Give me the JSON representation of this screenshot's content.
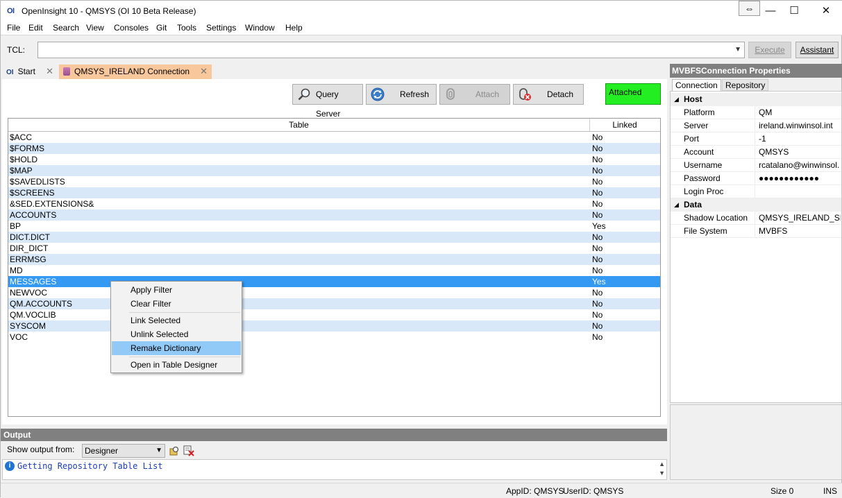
{
  "window": {
    "app_logo": "OI",
    "title": "OpenInsight 10 - QMSYS (OI 10 Beta Release)",
    "swap_glyph": "⇔",
    "minimize_glyph": "—",
    "maximize_glyph": "☐",
    "close_glyph": "✕"
  },
  "menu": [
    "File",
    "Edit",
    "Search",
    "View",
    "Consoles",
    "Git",
    "Tools",
    "Settings",
    "Window",
    "Help"
  ],
  "tcl": {
    "label": "TCL:",
    "value": "",
    "execute_label": "Execute",
    "assistant_label": "Assistant"
  },
  "tabs": {
    "start_label": "Start",
    "start_logo": "OI",
    "connection_label": "QMSYS_IRELAND Connection",
    "close_glyph": "✕"
  },
  "toolbar": {
    "query_label": "Query Server",
    "refresh_label": "Refresh",
    "attach_label": "Attach",
    "detach_label": "Detach",
    "attached_status": "Attached"
  },
  "grid": {
    "col_table": "Table",
    "col_linked": "Linked",
    "rows": [
      {
        "table": "$ACC",
        "linked": "No"
      },
      {
        "table": "$FORMS",
        "linked": "No"
      },
      {
        "table": "$HOLD",
        "linked": "No"
      },
      {
        "table": "$MAP",
        "linked": "No"
      },
      {
        "table": "$SAVEDLISTS",
        "linked": "No"
      },
      {
        "table": "$SCREENS",
        "linked": "No"
      },
      {
        "table": "&SED.EXTENSIONS&",
        "linked": "No"
      },
      {
        "table": "ACCOUNTS",
        "linked": "No"
      },
      {
        "table": "BP",
        "linked": "Yes"
      },
      {
        "table": "DICT.DICT",
        "linked": "No"
      },
      {
        "table": "DIR_DICT",
        "linked": "No"
      },
      {
        "table": "ERRMSG",
        "linked": "No"
      },
      {
        "table": "MD",
        "linked": "No"
      },
      {
        "table": "MESSAGES",
        "linked": "Yes"
      },
      {
        "table": "NEWVOC",
        "linked": "No"
      },
      {
        "table": "QM.ACCOUNTS",
        "linked": "No"
      },
      {
        "table": "QM.VOCLIB",
        "linked": "No"
      },
      {
        "table": "SYSCOM",
        "linked": "No"
      },
      {
        "table": "VOC",
        "linked": "No"
      }
    ],
    "selected_row": "MESSAGES"
  },
  "context_menu": {
    "apply_filter": "Apply Filter",
    "clear_filter": "Clear Filter",
    "link_selected": "Link Selected",
    "unlink_selected": "Unlink Selected",
    "remake_dictionary": "Remake Dictionary",
    "open_designer": "Open in Table Designer"
  },
  "properties": {
    "title": "MVBFSConnection Properties",
    "tab_connection": "Connection",
    "tab_repository": "Repository",
    "cat_host": "Host",
    "cat_data": "Data",
    "host": [
      {
        "name": "Platform",
        "value": "QM"
      },
      {
        "name": "Server",
        "value": "ireland.winwinsol.int"
      },
      {
        "name": "Port",
        "value": "-1"
      },
      {
        "name": "Account",
        "value": "QMSYS"
      },
      {
        "name": "Username",
        "value": "rcatalano@winwinsol."
      },
      {
        "name": "Password",
        "value": "●●●●●●●●●●●●"
      },
      {
        "name": "Login Proc",
        "value": ""
      }
    ],
    "data": [
      {
        "name": "Shadow Location",
        "value": "QMSYS_IRELAND_SHA"
      },
      {
        "name": "File System",
        "value": "MVBFS"
      }
    ]
  },
  "output": {
    "title": "Output",
    "show_from_label": "Show output from:",
    "source_value": "Designer",
    "message": "Getting Repository Table List"
  },
  "status": {
    "appid": "AppID: QMSYS",
    "userid": "UserID: QMSYS",
    "size": "Size 0",
    "mode": "INS"
  },
  "colors": {
    "selection": "#3399f3",
    "alt_row": "#d9e8f8",
    "attached_green": "#22ee22",
    "active_tab": "#f8c79b",
    "panel_header": "#808080"
  }
}
